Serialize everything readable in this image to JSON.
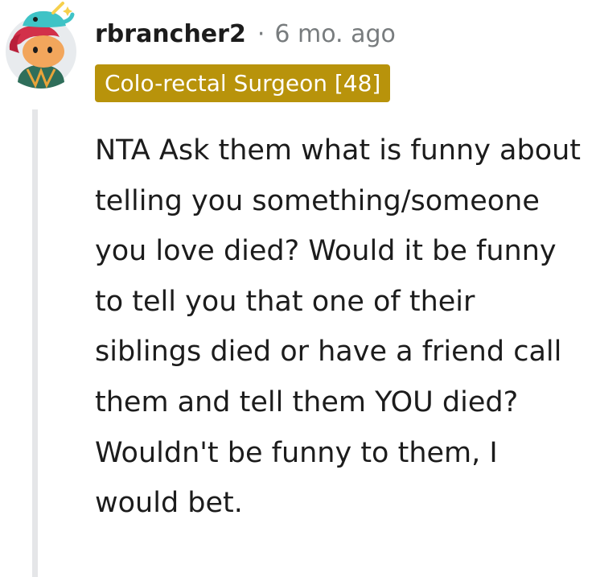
{
  "comment": {
    "author": "rbrancher2",
    "separator": "·",
    "timestamp": "6 mo. ago",
    "flair": {
      "text": "Colo-rectal Surgeon [48]",
      "color": "#b8930b"
    },
    "body": "NTA Ask them what is funny about telling you something/someone you love died? Would it be funny to tell you that one of their siblings died or have a friend call them and tell them YOU died? Wouldn't be funny to them, I would bet."
  },
  "colors": {
    "text": "#1c1c1c",
    "meta": "#787c7e",
    "thread_line": "#e5e6e8"
  },
  "icons": {
    "avatar": "snoo-avatar-with-narwhal-hat"
  }
}
